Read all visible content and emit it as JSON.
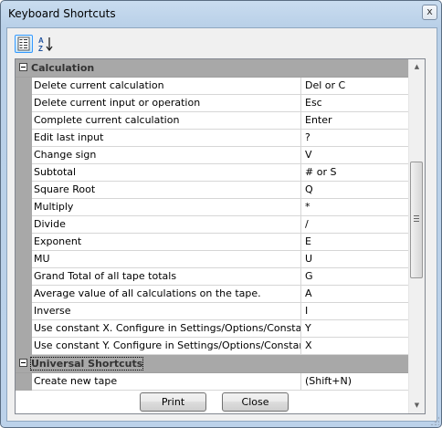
{
  "window": {
    "title": "Keyboard Shortcuts",
    "close_glyph": "x"
  },
  "toolbar": {
    "categorized_icon": "categorized-view-icon",
    "alphabetical_icon": "sort-az-icon"
  },
  "grid": {
    "categories": [
      {
        "label": "Calculation",
        "rows": [
          {
            "name": "Delete current calculation",
            "value": "Del or C"
          },
          {
            "name": "Delete current input or operation",
            "value": "Esc"
          },
          {
            "name": "Complete current calculation",
            "value": "Enter"
          },
          {
            "name": "Edit last input",
            "value": "?"
          },
          {
            "name": "Change sign",
            "value": "V"
          },
          {
            "name": "Subtotal",
            "value": "# or S"
          },
          {
            "name": "Square Root",
            "value": "Q"
          },
          {
            "name": "Multiply",
            "value": "*"
          },
          {
            "name": "Divide",
            "value": "/"
          },
          {
            "name": "Exponent",
            "value": "E"
          },
          {
            "name": "MU",
            "value": "U"
          },
          {
            "name": "Grand Total of all tape totals",
            "value": "G"
          },
          {
            "name": "Average value of all calculations on the tape.",
            "value": "A"
          },
          {
            "name": "Inverse",
            "value": "I"
          },
          {
            "name": "Use constant X. Configure in Settings/Options/Constants",
            "value": "Y"
          },
          {
            "name": "Use constant Y. Configure in Settings/Options/Constants",
            "value": "X"
          }
        ]
      },
      {
        "label": "Universal Shortcuts",
        "rows": [
          {
            "name": "Create new tape",
            "value": "(Shift+N)"
          }
        ]
      }
    ]
  },
  "buttons": {
    "print_label": "Print",
    "close_label": "Close"
  }
}
